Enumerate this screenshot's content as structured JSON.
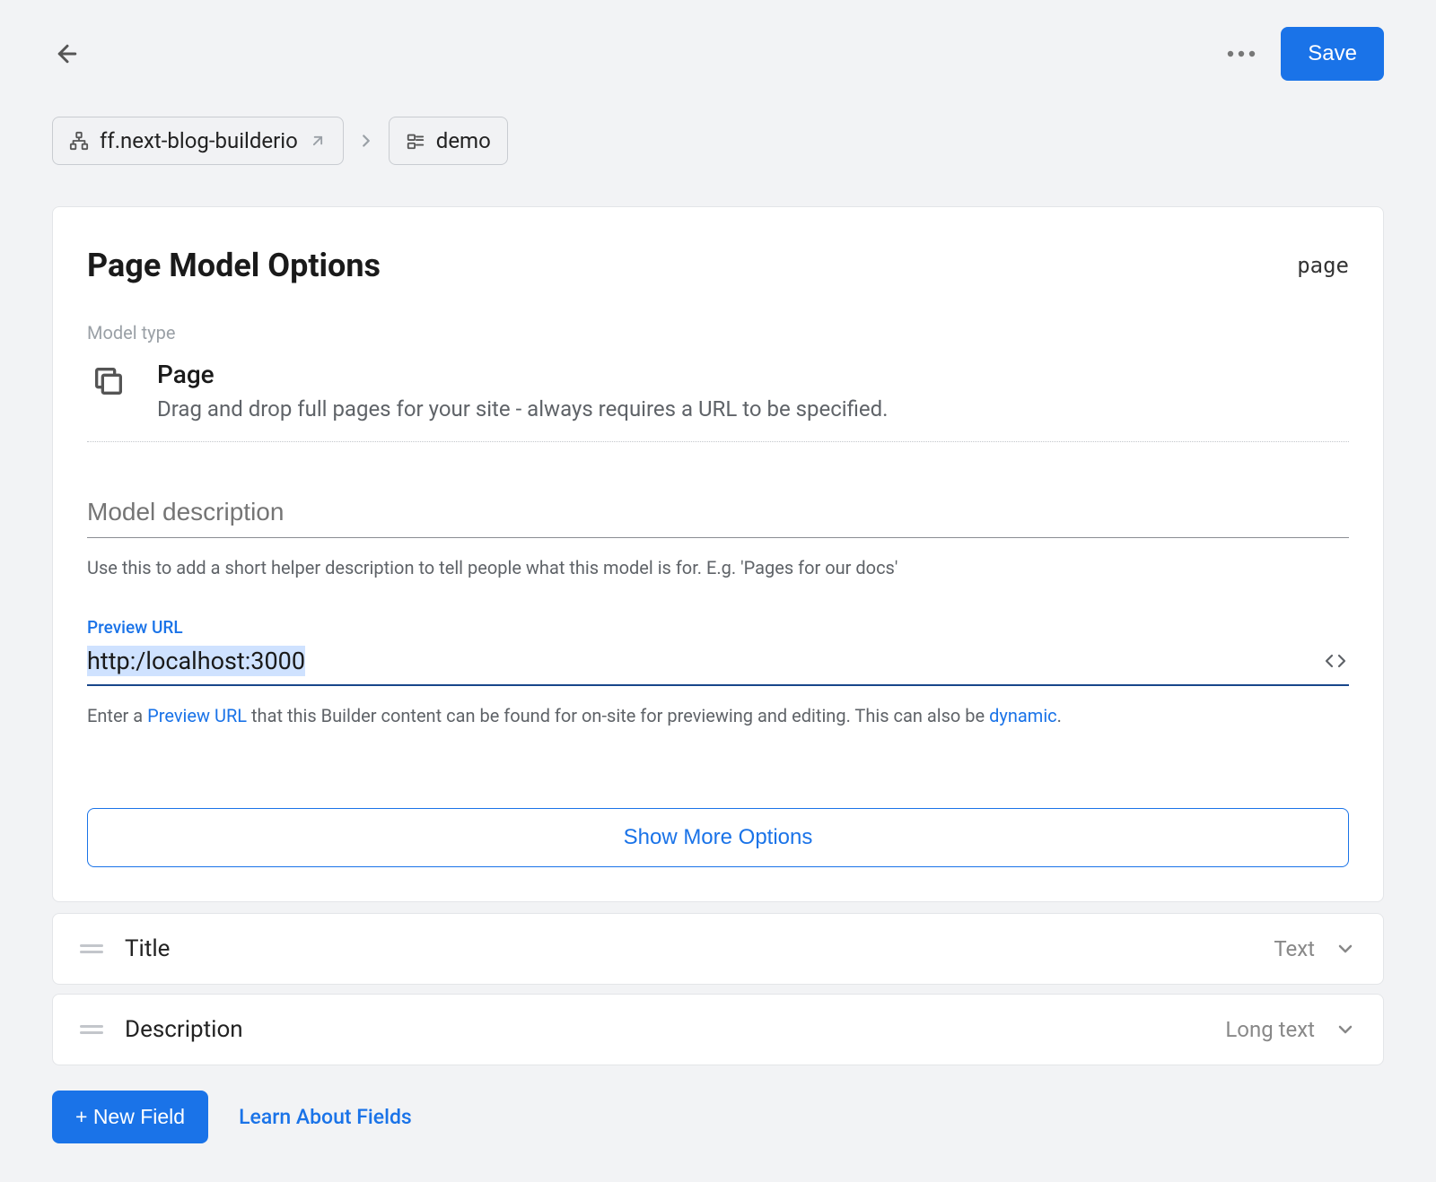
{
  "topbar": {
    "save_label": "Save"
  },
  "breadcrumb": {
    "root": "ff.next-blog-builderio",
    "current": "demo"
  },
  "card": {
    "title": "Page Model Options",
    "tag": "page",
    "model_type_label": "Model type",
    "type_name": "Page",
    "type_desc": "Drag and drop full pages for your site - always requires a URL to be specified.",
    "description_placeholder": "Model description",
    "description_help": "Use this to add a short helper description to tell people what this model is for. E.g. 'Pages for our docs'",
    "preview_label": "Preview URL",
    "preview_value": "http:/localhost:3000",
    "preview_help_pre": "Enter a ",
    "preview_help_link1": "Preview URL",
    "preview_help_mid": " that this Builder content can be found for on-site for previewing and editing. This can also be ",
    "preview_help_link2": "dynamic",
    "preview_help_post": ".",
    "show_more_label": "Show More Options"
  },
  "fields": [
    {
      "name": "Title",
      "type": "Text"
    },
    {
      "name": "Description",
      "type": "Long text"
    }
  ],
  "bottom": {
    "new_field_label": "+ New Field",
    "learn_label": "Learn About Fields"
  }
}
